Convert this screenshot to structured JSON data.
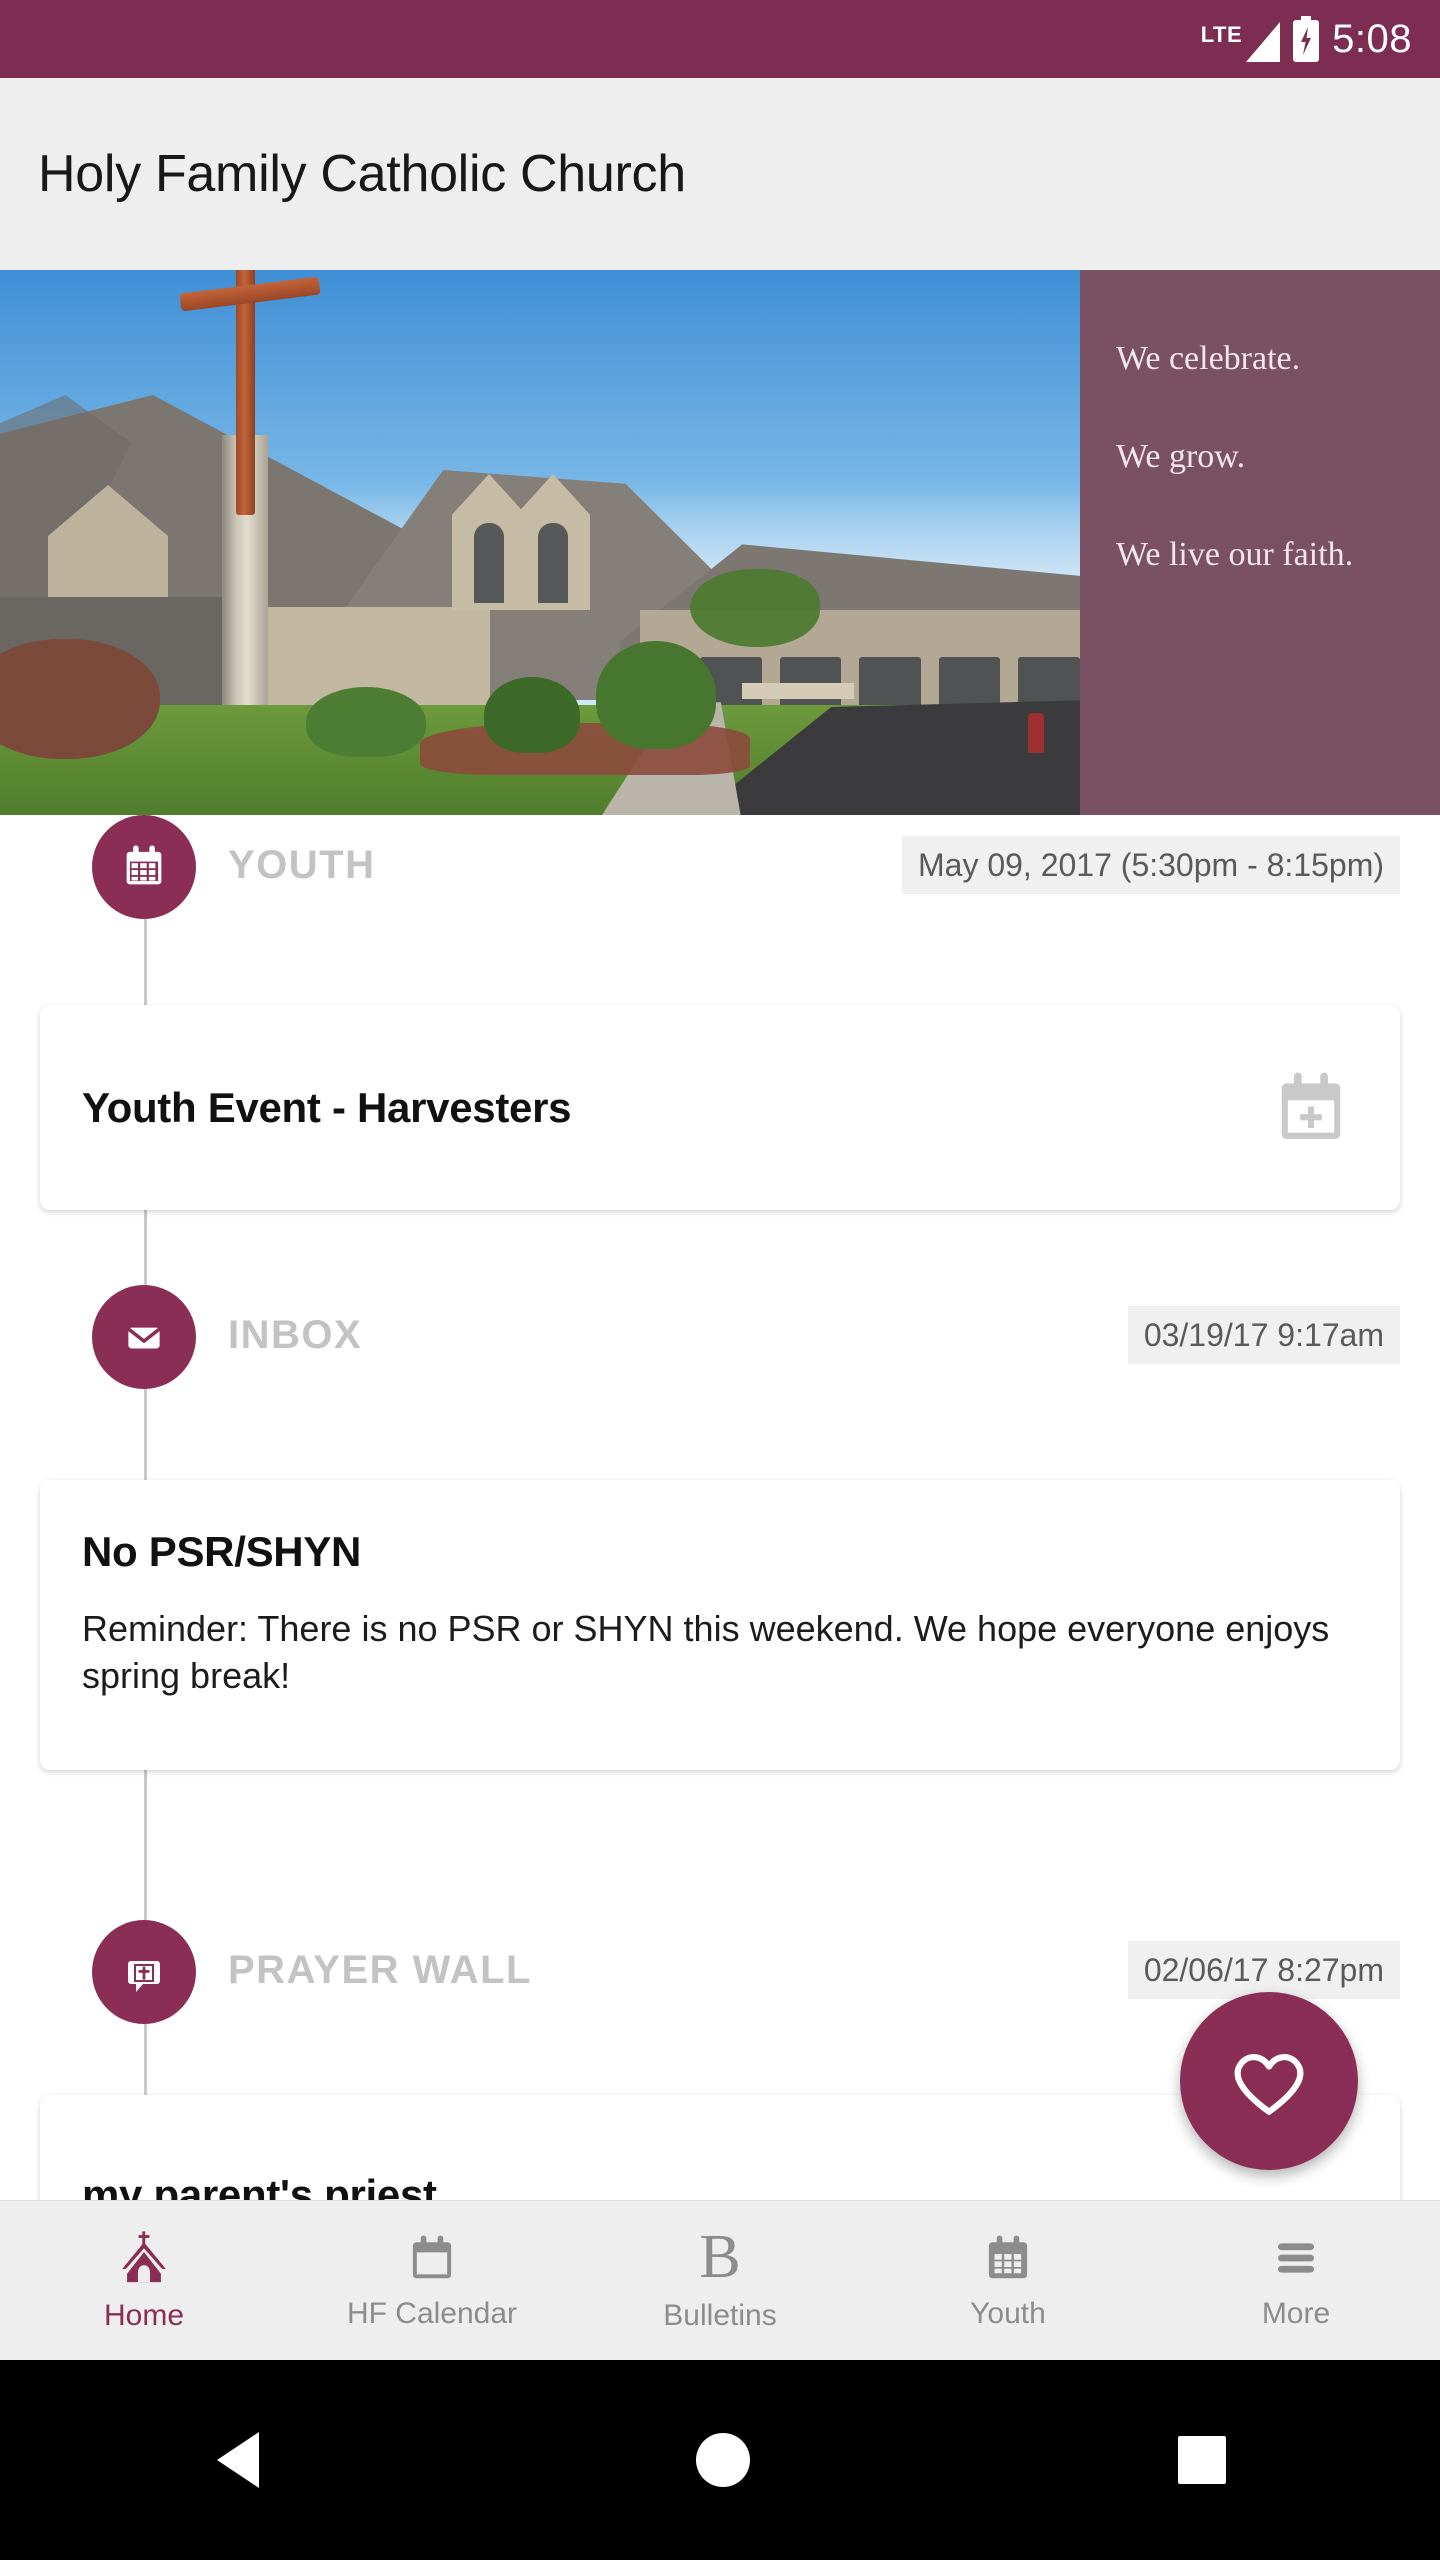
{
  "status_bar": {
    "network": "LTE",
    "time": "5:08",
    "icons": [
      "lte-label",
      "signal-icon",
      "battery-charging-icon"
    ]
  },
  "app_bar": {
    "title": "Holy Family Catholic Church"
  },
  "hero": {
    "image_alt": "church-exterior-photo",
    "taglines": [
      "We celebrate.",
      "We grow.",
      "We live our faith."
    ],
    "panel_color": "#7a5163"
  },
  "feed": {
    "items": [
      {
        "category": "YOUTH",
        "icon": "calendar-icon",
        "timestamp": "May 09, 2017 (5:30pm - 8:15pm)",
        "title": "Youth Event - Harvesters",
        "body": "",
        "action_icon": "add-to-calendar-icon"
      },
      {
        "category": "INBOX",
        "icon": "envelope-icon",
        "timestamp": "03/19/17 9:17am",
        "title": "No PSR/SHYN",
        "body": "Reminder: There is no PSR or SHYN this weekend. We hope everyone enjoys spring break!",
        "action_icon": ""
      },
      {
        "category": "PRAYER WALL",
        "icon": "prayer-bubble-icon",
        "timestamp": "02/06/17 8:27pm",
        "title": "my parent's priest",
        "body": "",
        "action_icon": ""
      }
    ]
  },
  "fab": {
    "icon": "heart-icon",
    "label": ""
  },
  "bottom_nav": {
    "active_index": 0,
    "items": [
      {
        "label": "Home",
        "icon": "church-icon"
      },
      {
        "label": "HF Calendar",
        "icon": "calendar-blank-icon"
      },
      {
        "label": "Bulletins",
        "icon": "bulletin-b-icon"
      },
      {
        "label": "Youth",
        "icon": "calendar-grid-icon"
      },
      {
        "label": "More",
        "icon": "hamburger-icon"
      }
    ]
  },
  "android_nav": {
    "items": [
      {
        "name": "back",
        "icon": "triangle-back-icon"
      },
      {
        "name": "home",
        "icon": "circle-home-icon"
      },
      {
        "name": "recents",
        "icon": "square-recents-icon"
      }
    ]
  },
  "theme": {
    "primary": "#7c2d51",
    "accent": "#8a2e55",
    "panel": "#7a5163",
    "surface": "#ffffff",
    "chrome": "#efeeee"
  }
}
